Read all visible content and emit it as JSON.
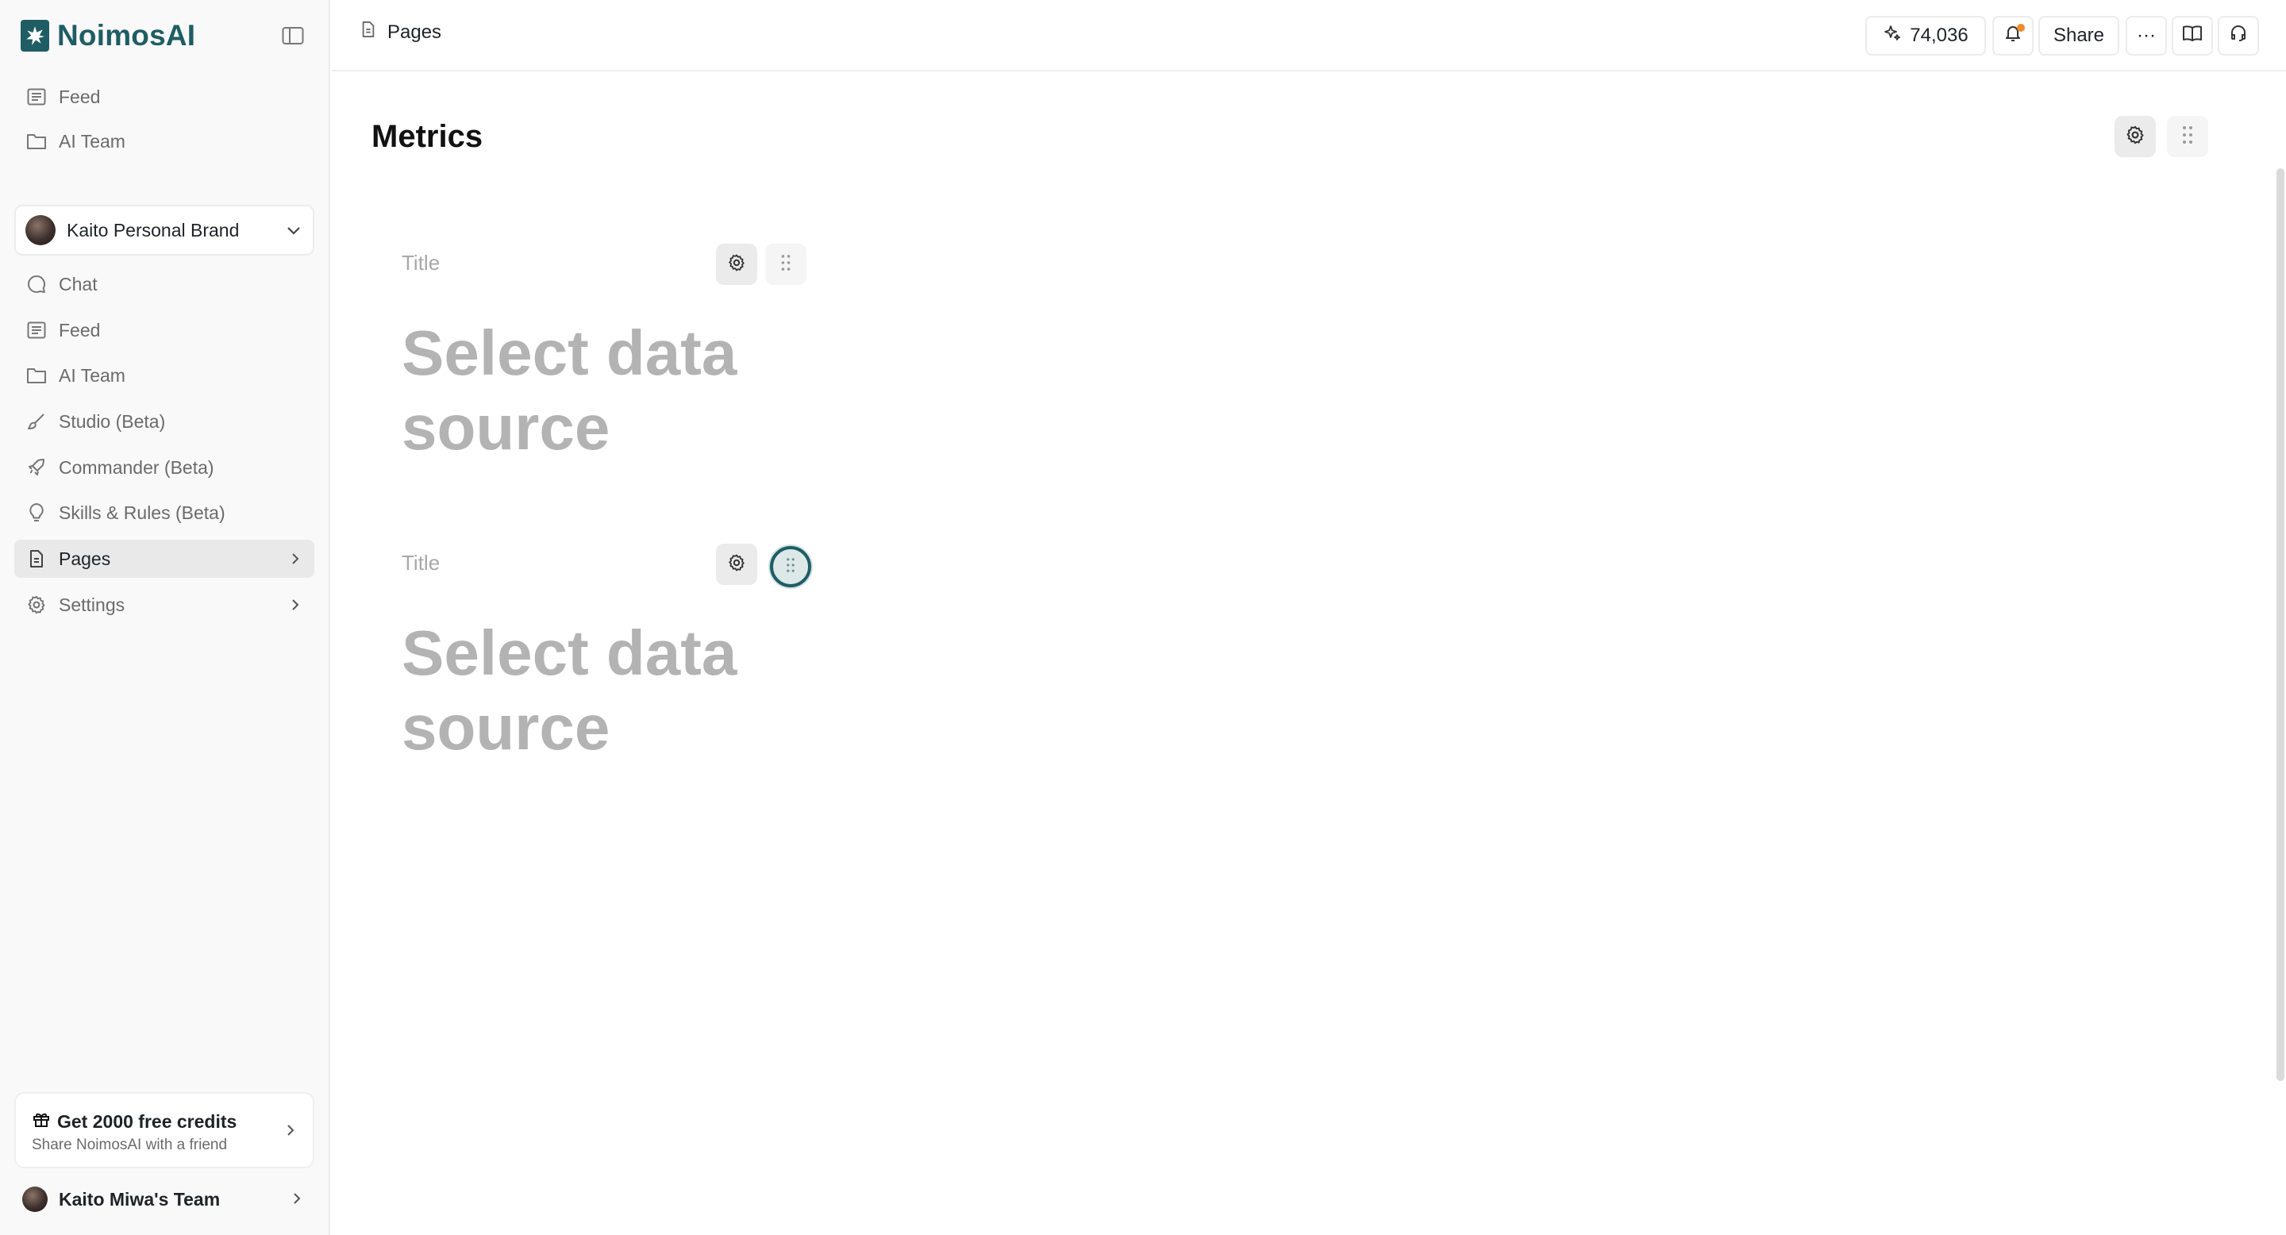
{
  "app": {
    "name": "NoimosAI"
  },
  "sidebar": {
    "top_items": [
      {
        "label": "Feed",
        "icon": "feed-icon"
      },
      {
        "label": "AI Team",
        "icon": "folder-icon"
      }
    ],
    "project": {
      "name": "Kaito Personal Brand"
    },
    "items": [
      {
        "label": "Chat",
        "icon": "chat-icon"
      },
      {
        "label": "Feed",
        "icon": "feed-icon"
      },
      {
        "label": "AI Team",
        "icon": "folder-icon"
      },
      {
        "label": "Studio (Beta)",
        "icon": "brush-icon"
      },
      {
        "label": "Commander (Beta)",
        "icon": "rocket-icon"
      },
      {
        "label": "Skills & Rules (Beta)",
        "icon": "lightbulb-icon"
      },
      {
        "label": "Pages",
        "icon": "pages-icon",
        "active": true
      },
      {
        "label": "Settings",
        "icon": "gear-icon"
      }
    ],
    "promo": {
      "title": "Get 2000 free credits",
      "subtitle": "Share NoimosAI with a friend"
    },
    "team": {
      "name": "Kaito Miwa's Team"
    }
  },
  "topbar": {
    "breadcrumb": "Pages",
    "credits": "74,036",
    "share_label": "Share",
    "more_label": "···"
  },
  "main": {
    "title": "Metrics",
    "widgets": [
      {
        "title": "Title",
        "value": "Select data source"
      },
      {
        "title": "Title",
        "value": "Select data source"
      }
    ]
  },
  "colors": {
    "brand": "#1f5d64",
    "notification": "#f08c2e"
  }
}
